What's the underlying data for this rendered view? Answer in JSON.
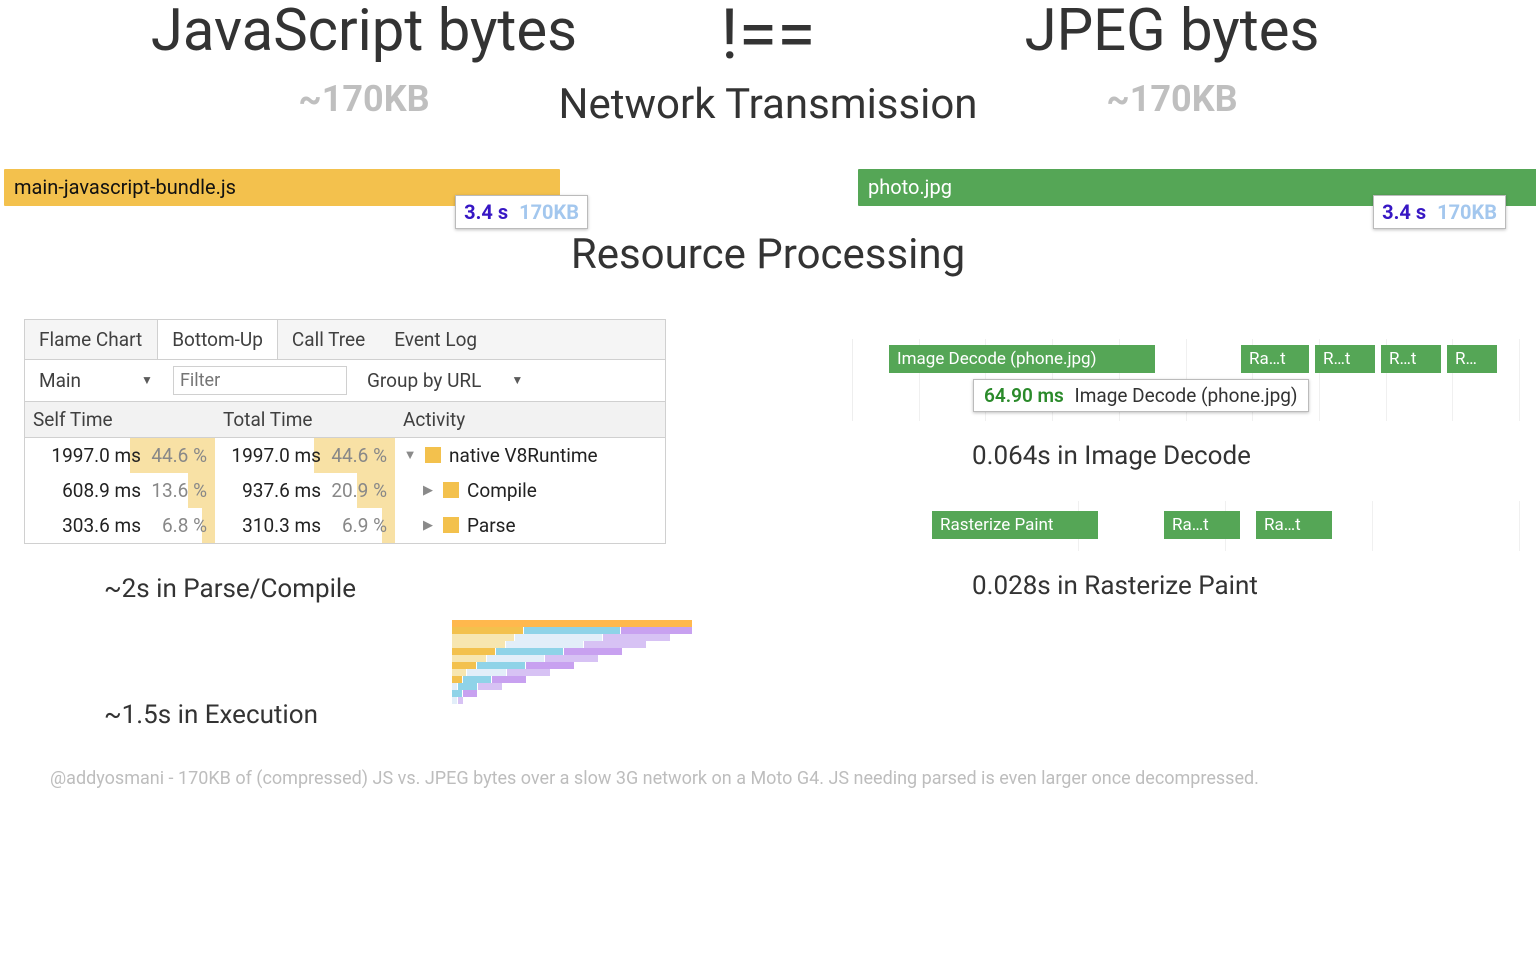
{
  "header": {
    "left_title": "JavaScript bytes",
    "center_symbol": "!==",
    "right_title": "JPEG bytes",
    "left_size": "~170KB",
    "right_size": "~170KB"
  },
  "sections": {
    "network": "Network Transmission",
    "processing": "Resource Processing"
  },
  "network": {
    "js_file": "main-javascript-bundle.js",
    "img_file": "photo.jpg",
    "js_time": "3.4 s",
    "js_size": "170KB",
    "img_time": "3.4 s",
    "img_size": "170KB"
  },
  "devtools": {
    "tabs": [
      "Flame Chart",
      "Bottom-Up",
      "Call Tree",
      "Event Log"
    ],
    "active_tab": "Bottom-Up",
    "thread_label": "Main",
    "filter_placeholder": "Filter",
    "groupby_label": "Group by URL",
    "headers": {
      "self": "Self Time",
      "total": "Total Time",
      "activity": "Activity"
    },
    "rows": [
      {
        "self_ms": "1997.0 ms",
        "self_pct": "44.6 %",
        "total_ms": "1997.0 ms",
        "total_pct": "44.6 %",
        "activity": "native V8Runtime",
        "self_bar": 45,
        "total_bar": 45,
        "depth": 0
      },
      {
        "self_ms": "608.9 ms",
        "self_pct": "13.6 %",
        "total_ms": "937.6 ms",
        "total_pct": "20.9 %",
        "activity": "Compile",
        "self_bar": 14,
        "total_bar": 21,
        "depth": 1
      },
      {
        "self_ms": "303.6 ms",
        "self_pct": "6.8 %",
        "total_ms": "310.3 ms",
        "total_pct": "6.9 %",
        "activity": "Parse",
        "self_bar": 7,
        "total_bar": 7,
        "depth": 1
      }
    ]
  },
  "summaries": {
    "parse_compile": "~2s in Parse/Compile",
    "execution": "~1.5s in Execution",
    "image_decode": "0.064s in Image Decode",
    "raster": "0.028s in Rasterize Paint"
  },
  "image_timeline": {
    "main_label": "Image Decode (phone.jpg)",
    "extras": [
      "Ra…t",
      "R…t",
      "R…t",
      "R…"
    ],
    "tooltip_ms": "64.90 ms",
    "tooltip_label": "Image Decode (phone.jpg)"
  },
  "raster_timeline": {
    "main_label": "Rasterize Paint",
    "extras": [
      "Ra…t",
      "Ra…t"
    ]
  },
  "footnote": "@addyosmani - 170KB of (compressed) JS vs. JPEG bytes over a slow 3G network on a Moto G4. JS needing parsed is even larger once decompressed."
}
